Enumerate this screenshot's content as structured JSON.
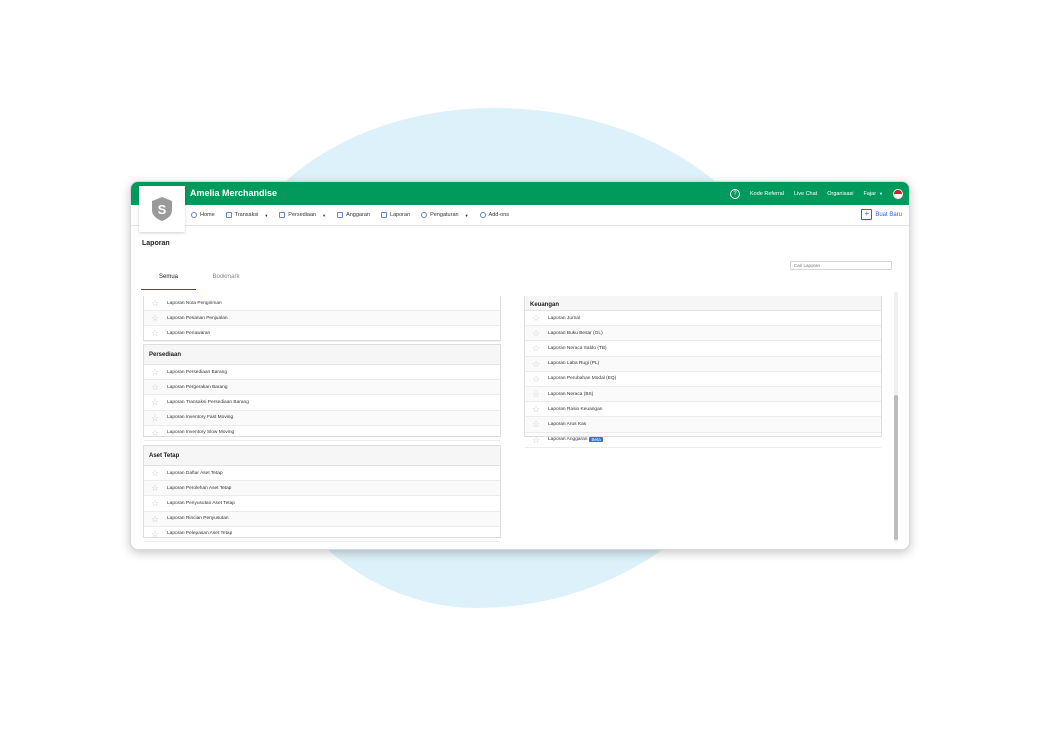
{
  "app": {
    "title": "Amelia Merchandise",
    "logo_letter": "S"
  },
  "topbar": {
    "help_icon": "question-circle-icon",
    "links": [
      "Kode Referral",
      "Live Chat",
      "Organisasi"
    ],
    "user_name": "Fajar",
    "flag_icon": "indonesia-flag-icon"
  },
  "nav": {
    "items": [
      {
        "label": "Home",
        "icon": "home-icon"
      },
      {
        "label": "Transaksi",
        "icon": "cash-icon",
        "dropdown": true
      },
      {
        "label": "Persediaan",
        "icon": "box-icon",
        "dropdown": true
      },
      {
        "label": "Anggaran",
        "icon": "notebook-icon"
      },
      {
        "label": "Laporan",
        "icon": "document-icon"
      },
      {
        "label": "Pengaturan",
        "icon": "gear-icon",
        "dropdown": true
      },
      {
        "label": "Add-ons",
        "icon": "tag-icon"
      }
    ],
    "create_button": "Buat Baru"
  },
  "page": {
    "title": "Laporan",
    "search_placeholder": "Cari Laporan",
    "tabs": [
      "Semua",
      "Bookmark"
    ]
  },
  "panels": {
    "penjualan": {
      "rows": [
        "Laporan Nota Pengiriman",
        "Laporan Pesanan Penjualan",
        "Laporan Penawaran"
      ]
    },
    "persediaan": {
      "title": "Persediaan",
      "rows": [
        "Laporan Persediaan Barang",
        "Laporan Pergerakan Barang",
        "Laporan Transaksi Persediaan Barang",
        "Laporan Inventory Fast Moving",
        "Laporan Inventory Slow Moving"
      ]
    },
    "aset_tetap": {
      "title": "Aset Tetap",
      "rows": [
        "Laporan Daftar Aset Tetap",
        "Laporan Perolehan Aset Tetap",
        "Laporan Penyusutan Aset Tetap",
        "Laporan Rincian Penyusutan",
        "Laporan Pelepasan Aset Tetap"
      ]
    },
    "keuangan": {
      "title": "Keuangan",
      "rows": [
        "Laporan Jurnal",
        "Laporan Buku Besar (GL)",
        "Laporan Neraca Saldo (TB)",
        "Laporan Laba Rugi (PL)",
        "Laporan Perubahan Modal (EQ)",
        "Laporan Neraca (BS)",
        "Laporan Rasio Keuangan",
        "Laporan Arus Kas",
        "Laporan Anggaran"
      ],
      "beta_label": "Beta"
    }
  },
  "colors": {
    "primary_green": "#009b5c",
    "accent_blue": "#2c66d8",
    "tab_underline": "#5a34c4",
    "background_blob": "#dcf1f9"
  }
}
